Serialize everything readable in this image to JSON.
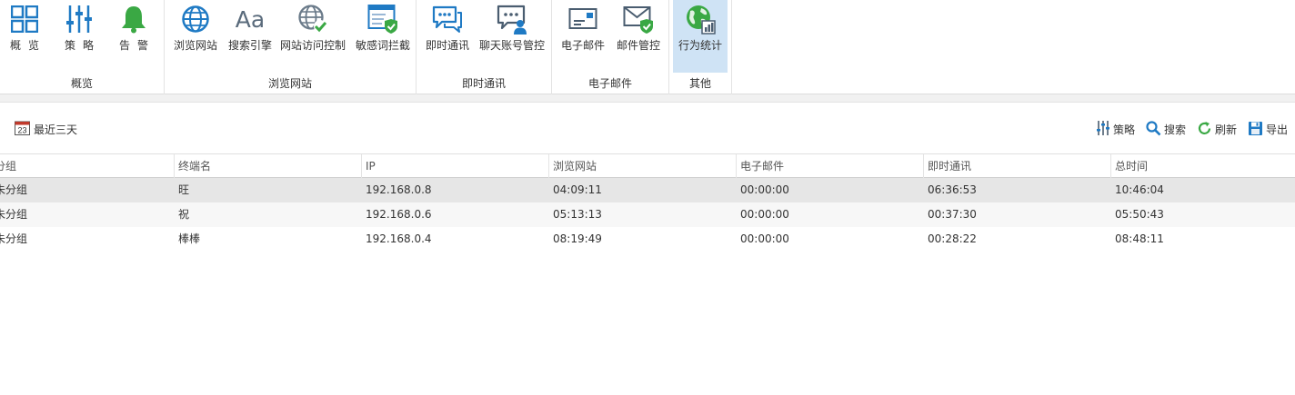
{
  "ribbon": {
    "groups": [
      {
        "label": "概览"
      },
      {
        "label": "浏览网站"
      },
      {
        "label": "即时通讯"
      },
      {
        "label": "电子邮件"
      },
      {
        "label": "其他"
      }
    ],
    "buttons": {
      "overview": {
        "label": "概览",
        "icon": "dashboard-grid-icon"
      },
      "policy": {
        "label": "策略",
        "icon": "sliders-icon"
      },
      "alert": {
        "label": "告警",
        "icon": "bell-icon"
      },
      "browse_web": {
        "label": "浏览网站",
        "icon": "globe-icon"
      },
      "search_engine": {
        "label": "搜索引擎",
        "icon": "font-aa-icon"
      },
      "web_access_control": {
        "label": "网站访问控制",
        "icon": "globe-check-icon"
      },
      "keyword_block": {
        "label": "敏感词拦截",
        "icon": "window-shield-icon"
      },
      "instant_message": {
        "label": "即时通讯",
        "icon": "chat-bubbles-icon"
      },
      "chat_account_control": {
        "label": "聊天账号管控",
        "icon": "chat-user-icon"
      },
      "email": {
        "label": "电子邮件",
        "icon": "envelope-card-icon"
      },
      "email_control": {
        "label": "邮件管控",
        "icon": "envelope-shield-icon"
      },
      "behavior_stats": {
        "label": "行为统计",
        "icon": "globe-chart-icon",
        "active": true
      }
    }
  },
  "toolbar": {
    "date_filter": {
      "label": "最近三天",
      "icon_day": "23"
    },
    "policy": "策略",
    "search": "搜索",
    "refresh": "刷新",
    "export": "导出"
  },
  "table": {
    "columns": [
      "分组",
      "终端名",
      "IP",
      "浏览网站",
      "电子邮件",
      "即时通讯",
      "总时间"
    ],
    "rows": [
      [
        "未分组",
        "旺",
        "192.168.0.8",
        "04:09:11",
        "00:00:00",
        "06:36:53",
        "10:46:04"
      ],
      [
        "未分组",
        "祝",
        "192.168.0.6",
        "05:13:13",
        "00:00:00",
        "00:37:30",
        "05:50:43"
      ],
      [
        "未分组",
        "棒棒",
        "192.168.0.4",
        "08:19:49",
        "00:00:00",
        "00:28:22",
        "08:48:11"
      ]
    ]
  },
  "colors": {
    "accent_blue": "#1f7ac4",
    "green": "#3aa844",
    "selected_tab_bg": "#cfe3f5"
  }
}
